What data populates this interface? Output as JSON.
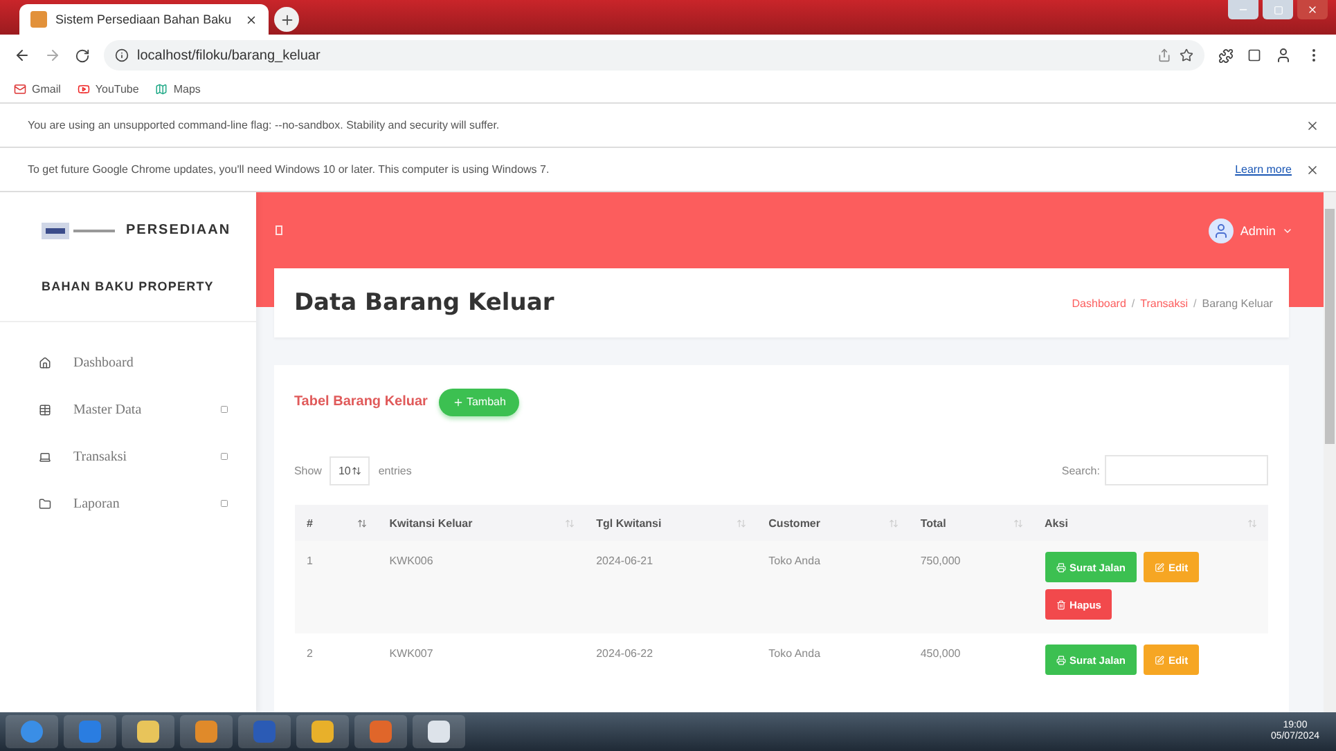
{
  "browser": {
    "tab_title": "Sistem Persediaan Bahan Baku",
    "url": "localhost/filoku/barang_keluar",
    "bookmarks": [
      {
        "label": "Gmail"
      },
      {
        "label": "YouTube"
      },
      {
        "label": "Maps"
      }
    ],
    "infobars": [
      {
        "text": "You are using an unsupported command-line flag: --no-sandbox. Stability and security will suffer."
      },
      {
        "text": "To get future Google Chrome updates, you'll need Windows 10 or later. This computer is using Windows 7.",
        "link": "Learn more"
      }
    ]
  },
  "sidebar": {
    "brand": "PERSEDIAAN",
    "subtitle": "BAHAN BAKU PROPERTY",
    "items": [
      {
        "label": "Dashboard",
        "submenu": false
      },
      {
        "label": "Master Data",
        "submenu": true
      },
      {
        "label": "Transaksi",
        "submenu": true
      },
      {
        "label": "Laporan",
        "submenu": true
      }
    ]
  },
  "header": {
    "user": "Admin"
  },
  "page": {
    "title": "Data Barang Keluar",
    "breadcrumb": [
      "Dashboard",
      "Transaksi",
      "Barang Keluar"
    ],
    "breadcrumb_separator": "/"
  },
  "table": {
    "title": "Tabel Barang Keluar",
    "add_button": "Tambah",
    "show_label": "Show",
    "length": "10",
    "entries_label": "entries",
    "search_label": "Search:",
    "columns": [
      "#",
      "Kwitansi Keluar",
      "Tgl Kwitansi",
      "Customer",
      "Total",
      "Aksi"
    ],
    "rows": [
      {
        "no": "1",
        "kwitansi": "KWK006",
        "tgl": "2024-06-21",
        "customer": "Toko Anda",
        "total": "750,000",
        "actions": [
          {
            "label": "Surat Jalan",
            "kind": "print"
          },
          {
            "label": "Edit",
            "kind": "edit"
          },
          {
            "label": "Hapus",
            "kind": "delete"
          }
        ]
      },
      {
        "no": "2",
        "kwitansi": "KWK007",
        "tgl": "2024-06-22",
        "customer": "Toko Anda",
        "total": "450,000",
        "actions": [
          {
            "label": "Surat Jalan",
            "kind": "print"
          },
          {
            "label": "Edit",
            "kind": "edit"
          }
        ]
      }
    ]
  },
  "taskbar": {
    "time": "19:00",
    "date": "05/07/2024"
  }
}
